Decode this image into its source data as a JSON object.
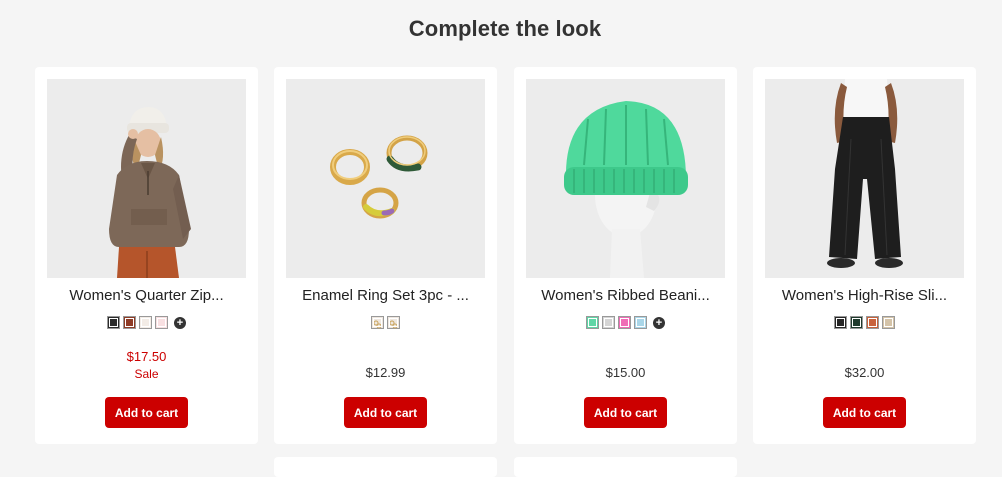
{
  "section": {
    "heading": "Complete the look"
  },
  "products": [
    {
      "name": "Women's Quarter Zip...",
      "swatches": [
        "#2b2b2b",
        "#8e3b26",
        "#f3ece6",
        "#f8dfe1"
      ],
      "more_icon": "plus-circle-icon",
      "price": "$17.50",
      "sale_label": "Sale",
      "button_label": "Add to cart"
    },
    {
      "name": "Enamel Ring Set 3pc - ...",
      "swatch_icons": [
        "ring-swatch-icon",
        "ring-swatch-icon"
      ],
      "price": "$12.99",
      "button_label": "Add to cart"
    },
    {
      "name": "Women's Ribbed Beani...",
      "swatches": [
        "#5fd6a6",
        "#d5d5d5",
        "#f06cb6",
        "#a9d6e8"
      ],
      "more_icon": "plus-circle-icon",
      "price": "$15.00",
      "button_label": "Add to cart"
    },
    {
      "name": "Women's High-Rise Sli...",
      "swatches": [
        "#262626",
        "#1f3a2d",
        "#c8623c",
        "#d4c3a8"
      ],
      "price": "$32.00",
      "button_label": "Add to cart"
    }
  ],
  "colors": {
    "accent_red": "#cc0000",
    "background": "#f5f5f5",
    "card": "#ffffff"
  }
}
